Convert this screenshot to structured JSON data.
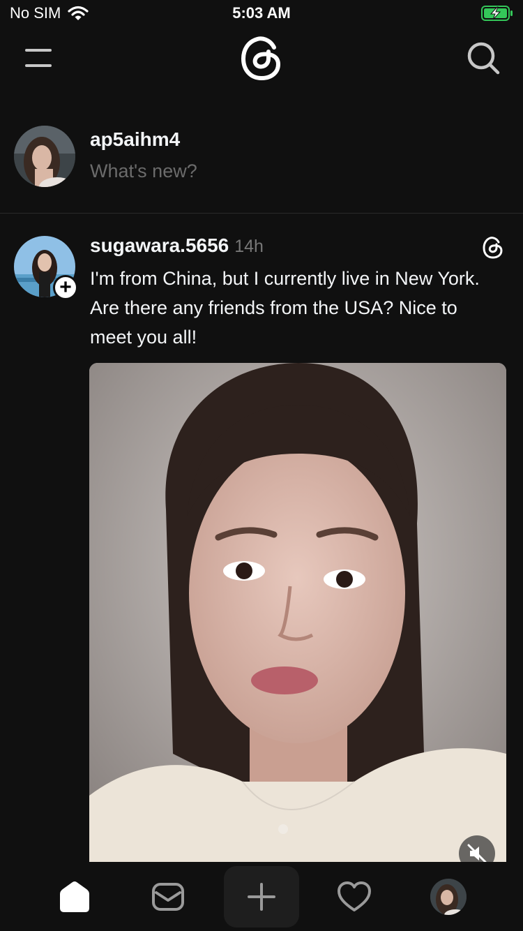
{
  "status_bar": {
    "carrier": "No SIM",
    "time": "5:03 AM"
  },
  "header": {
    "menu_icon": "hamburger-icon",
    "logo_icon": "threads-logo-icon",
    "search_icon": "search-icon"
  },
  "composer": {
    "username": "ap5aihm4",
    "placeholder": "What's new?"
  },
  "post": {
    "username": "sugawara.5656",
    "time": "14h",
    "text": "I'm from China, but I currently live in New York. Are there any friends from the USA? Nice to meet you all!",
    "follow_icon": "plus-icon",
    "source_icon": "threads-logo-icon",
    "mute_icon": "speaker-muted-icon"
  },
  "bottom_nav": {
    "items": [
      "home-icon",
      "inbox-icon",
      "compose-plus-icon",
      "heart-icon",
      "profile-avatar"
    ]
  },
  "colors": {
    "background": "#101010",
    "text_primary": "#f3f5f7",
    "text_secondary": "#6b6b6b",
    "battery_charging": "#34c759"
  }
}
